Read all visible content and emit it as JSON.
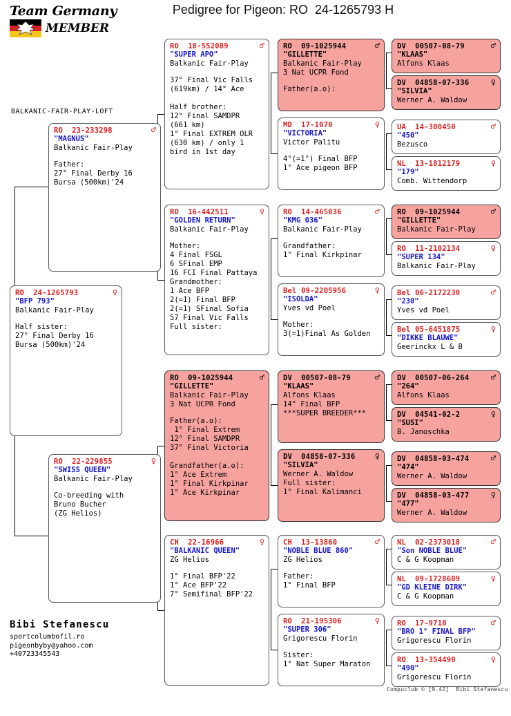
{
  "header": {
    "logo_line1": "Team Germany",
    "logo_line2": "MEMBER",
    "logo_icon": "german-flag-eagle",
    "title": "Pedigree for Pigeon: RO  24-1265793 H"
  },
  "loft_caption": "BALKANIC-FAIR-PLAY-LOFT",
  "breeder": {
    "name": "Bibi Stefanescu",
    "website": "sportcolumbofil.ro",
    "email": "pigeonbyby@yahoo.com",
    "phone": "+40723345543"
  },
  "credit": "Compuclub © [9.42]  Bibi Stefanescu",
  "colors": {
    "pink": "#f6a3a0",
    "white": "#ffffff",
    "id_red": "#e01b1b",
    "name_blue": "#1515c9"
  },
  "symbols": {
    "male": "♂",
    "female": "♀"
  },
  "birds": {
    "subject": {
      "id": "RO  24-1265793",
      "sex": "female",
      "name": "\"BFP 793\"",
      "owner": "Balkanic Fair-Play",
      "notes": "Half sister:\n27° Final Derby 16\nBursa (500km)'24",
      "pink": false
    },
    "sire": {
      "id": "RO  23-233298",
      "sex": "male",
      "name": "\"MAGNUS\"",
      "owner": "Balkanic Fair-Play",
      "notes": "Father:\n27° Final Derby 16\nBursa (500km)'24",
      "pink": false
    },
    "dam": {
      "id": "RO  22-229855",
      "sex": "female",
      "name": "\"SWISS QUEEN\"",
      "owner": "Balkanic Fair-Play",
      "notes": "Co-breeding with\nBruno Bucher\n(ZG Helios)",
      "pink": false
    },
    "g1": {
      "id": "RO  18-552089",
      "sex": "male",
      "name": "\"SUPER APO\"",
      "owner": "Balkanic Fair-Play",
      "notes": "37° Final Vic Falls\n(619km) / 14° Ace\n\nHalf brother:\n12° Final SAMDPR\n(661 km)\n1° Final EXTREM OLR\n(630 km) / only 1\nbird in 1st day",
      "pink": false
    },
    "g2": {
      "id": "RO  16-442511",
      "sex": "female",
      "name": "\"GOLDEN RETURN\"",
      "owner": "Balkanic Fair-Play",
      "notes": "Mother:\n4 Final FSGL\n6 SFinal EMP\n16 FCI Final Pattaya\nGrandmother:\n1 Ace BFP\n2(=1) Final BFP\n2(=1) SFinal Sofia\n57 Final Vic Falls\nFull sister:",
      "pink": false
    },
    "g3": {
      "id": "RO  09-1025944",
      "sex": "male",
      "name": "\"GILLETTE\"",
      "owner": "Balkanic Fair-Play",
      "line4": "3 Nat UCPR Fond",
      "notes": "Father(a.o):\n 1° Final Extrem\n12° Final SAMDPR\n37° Final Victoria\n\nGrandfather(a.o):\n1° Ace Extrem\n1° Final Kirkpinar\n1° Ace Kirkpinar",
      "pink": true
    },
    "g4": {
      "id": "CH  22-16966",
      "sex": "female",
      "name": "\"BALKANIC QUEEN\"",
      "owner": "ZG Helios",
      "notes": "1° Final BFP'22\n1° Ace BFP'22\n7° Semifinal BFP'22",
      "pink": false
    },
    "gg1": {
      "id": "RO  09-1025944",
      "sex": "male",
      "name": "\"GILLETTE\"",
      "owner": "Balkanic Fair-Play",
      "line4": "3 Nat UCPR Fond",
      "notes": "Father(a.o):",
      "pink": true
    },
    "gg2": {
      "id": "MD  17-1070",
      "sex": "female",
      "name": "\"VICTORIA\"",
      "owner": "Victor Palitu",
      "notes": "4°(=1°) Final BFP\n1° Ace pigeon BFP",
      "pink": false
    },
    "gg3": {
      "id": "RO  14-465036",
      "sex": "male",
      "name": "\"KMG 036\"",
      "owner": "Balkanic Fair-Play",
      "notes": "Grandfather:\n1° Final Kirkpinar",
      "pink": false
    },
    "gg4": {
      "id": "Bel 09-2205956",
      "sex": "female",
      "name": "\"ISOLDA\"",
      "owner": "Yves vd Poel",
      "notes": "Mother:\n3(=1)Final As Golden",
      "pink": false
    },
    "gg5": {
      "id": "DV  00507-08-79",
      "sex": "male",
      "name": "\"KLAAS\"",
      "owner": "Alfons Klaas",
      "line4": "14° Final BFP",
      "line5": "***SUPER BREEDER***",
      "notes": "",
      "pink": true
    },
    "gg6": {
      "id": "DV  04858-07-336",
      "sex": "female",
      "name": "\"SILVIA\"",
      "owner": "Werner A. Waldow",
      "line4": "Full sister:",
      "line5": "1° Final Kalimanci",
      "notes": "",
      "pink": true
    },
    "gg7": {
      "id": "CH  13-13860",
      "sex": "male",
      "name": "\"NOBLE BLUE 860\"",
      "owner": "ZG Helios",
      "notes": "Father:\n1° Final BFP",
      "pink": false
    },
    "gg8": {
      "id": "RO  21-195306",
      "sex": "female",
      "name": "\"SUPER 306\"",
      "owner": "Grigorescu Florin",
      "notes": "Sister:\n1° Nat Super Maraton",
      "pink": false
    },
    "ggg1": {
      "id": "DV  00507-08-79",
      "sex": "male",
      "name": "\"KLAAS\"",
      "owner": "Alfons Klaas",
      "pink": true
    },
    "ggg2": {
      "id": "DV  04858-07-336",
      "sex": "female",
      "name": "\"SILVIA\"",
      "owner": "Werner A. Waldow",
      "pink": true
    },
    "ggg3": {
      "id": "UA  14-300450",
      "sex": "male",
      "name": "\"450\"",
      "owner": "Bezusco",
      "pink": false
    },
    "ggg4": {
      "id": "NL  13-1812179",
      "sex": "female",
      "name": "\"179\"",
      "owner": "Comb. Wittendorp",
      "pink": false
    },
    "ggg5": {
      "id": "RO  09-1025944",
      "sex": "male",
      "name": "\"GILLETTE\"",
      "owner": "Balkanic Fair-Play",
      "pink": true
    },
    "ggg6": {
      "id": "RO  11-2102134",
      "sex": "female",
      "name": "\"SUPER 134\"",
      "owner": "Balkanic Fair-Play",
      "pink": false
    },
    "ggg7": {
      "id": "Bel 06-2172230",
      "sex": "male",
      "name": "\"230\"",
      "owner": "Yves vd Poel",
      "pink": false
    },
    "ggg8": {
      "id": "Bel 05-6451875",
      "sex": "female",
      "name": "\"DIKKE BLAUWE\"",
      "owner": "Geerinckx L & B",
      "pink": false
    },
    "ggg9": {
      "id": "DV  00507-06-264",
      "sex": "male",
      "name": "\"264\"",
      "owner": "Alfons Klaas",
      "pink": true
    },
    "ggg10": {
      "id": "DV  04541-02-2",
      "sex": "female",
      "name": "\"SUSI\"",
      "owner": "B. Janoschka",
      "pink": true
    },
    "ggg11": {
      "id": "DV  04858-03-474",
      "sex": "male",
      "name": "\"474\"",
      "owner": "Werner A. Waldow",
      "pink": true
    },
    "ggg12": {
      "id": "DV  04858-03-477",
      "sex": "female",
      "name": "\"477\"",
      "owner": "Werner A. Waldow",
      "pink": true
    },
    "ggg13": {
      "id": "NL  02-2373018",
      "sex": "male",
      "name": "\"Son NOBLE BLUE\"",
      "owner": "C & G Koopman",
      "pink": false
    },
    "ggg14": {
      "id": "NL  09-1728609",
      "sex": "female",
      "name": "\"GD KLEINE DIRK\"",
      "owner": "C & G Koopman",
      "pink": false
    },
    "ggg15": {
      "id": "RO  17-9710",
      "sex": "male",
      "name": "\"BRO 1° FINAL BFP\"",
      "owner": "Grigorescu Florin",
      "pink": false
    },
    "ggg16": {
      "id": "RO  13-354490",
      "sex": "female",
      "name": "\"490\"",
      "owner": "Grigorescu Florin",
      "pink": false
    }
  }
}
